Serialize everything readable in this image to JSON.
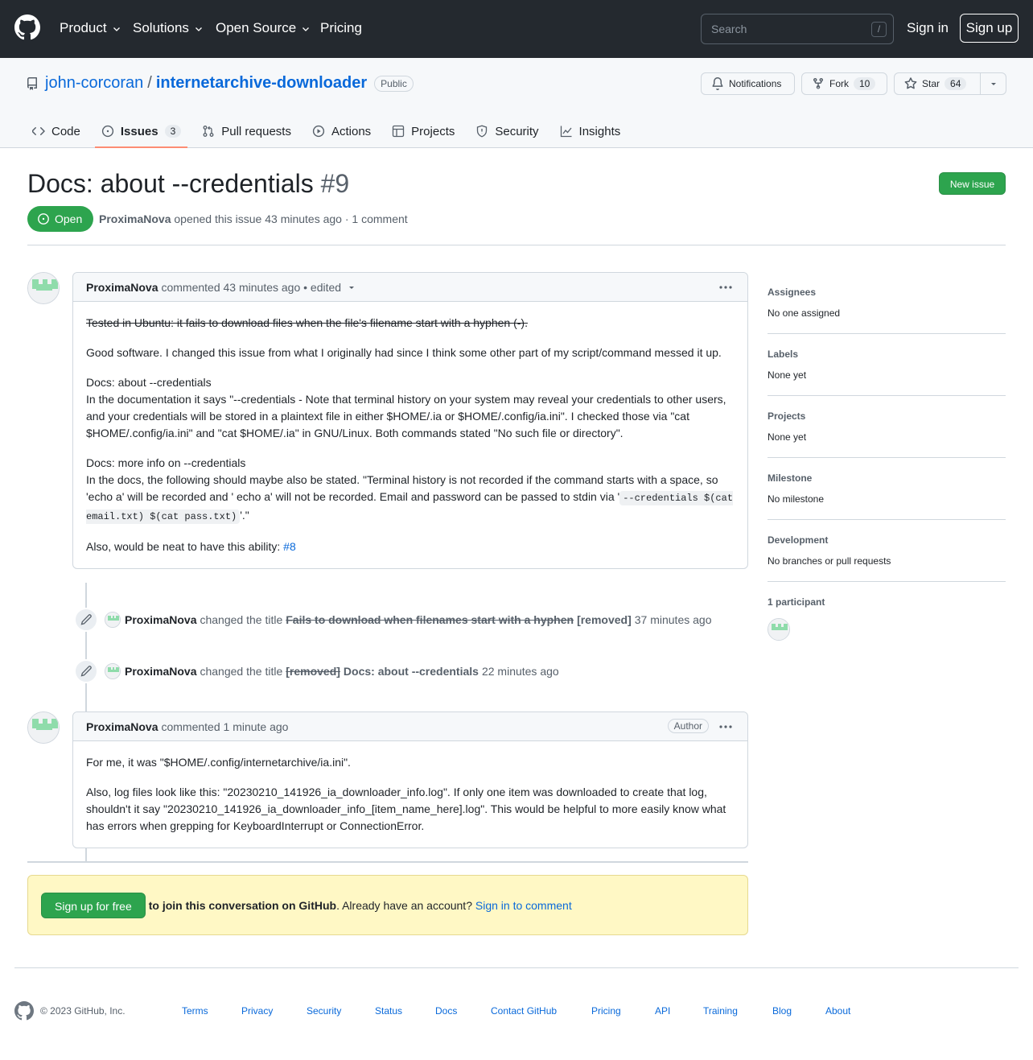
{
  "header": {
    "nav": [
      {
        "label": "Product",
        "has_dropdown": true
      },
      {
        "label": "Solutions",
        "has_dropdown": true
      },
      {
        "label": "Open Source",
        "has_dropdown": true
      },
      {
        "label": "Pricing",
        "has_dropdown": false
      }
    ],
    "search_placeholder": "Search",
    "search_shortcut": "/",
    "sign_in": "Sign in",
    "sign_up": "Sign up"
  },
  "repo": {
    "owner": "john-corcoran",
    "separator": "/",
    "name": "internetarchive-downloader",
    "visibility": "Public",
    "notifications_label": "Notifications",
    "fork_label": "Fork",
    "fork_count": "10",
    "star_label": "Star",
    "star_count": "64",
    "tabs": [
      {
        "label": "Code",
        "icon": "code-icon"
      },
      {
        "label": "Issues",
        "icon": "issue-opened-icon",
        "count": "3",
        "active": true
      },
      {
        "label": "Pull requests",
        "icon": "git-pull-request-icon"
      },
      {
        "label": "Actions",
        "icon": "play-icon"
      },
      {
        "label": "Projects",
        "icon": "table-icon"
      },
      {
        "label": "Security",
        "icon": "shield-icon"
      },
      {
        "label": "Insights",
        "icon": "graph-icon"
      }
    ]
  },
  "issue": {
    "title": "Docs: about --credentials",
    "number": "#9",
    "new_issue_label": "New issue",
    "state": "Open",
    "author": "ProximaNova",
    "meta_text": "opened this issue 43 minutes ago · 1 comment"
  },
  "timeline": {
    "comment1": {
      "author": "ProximaNova",
      "header_text": "commented 43 minutes ago • edited",
      "struck_line": "Tested in Ubuntu: it fails to download files when the file's filename start with a hyphen (-).",
      "p1": "Good software. I changed this issue from what I originally had since I think some other part of my script/command messed it up.",
      "p2_title": "Docs: about --credentials",
      "p2_body": "In the documentation it says \"--credentials - Note that terminal history on your system may reveal your credentials to other users, and your credentials will be stored in a plaintext file in either $HOME/.ia or $HOME/.config/ia.ini\". I checked those via \"cat $HOME/.config/ia.ini\" and \"cat $HOME/.ia\" in GNU/Linux. Both commands stated \"No such file or directory\".",
      "p3_title": "Docs: more info on --credentials",
      "p3_body_a": "In the docs, the following should maybe also be stated. \"Terminal history is not recorded if the command starts with a space, so 'echo a' will be recorded and ' echo a' will not be recorded. Email and password can be passed to stdin via '",
      "p3_code": "--credentials $(cat email.txt) $(cat pass.txt)",
      "p3_body_b": "'.\"",
      "p4_text": "Also, would be neat to have this ability:",
      "p4_link": "#8"
    },
    "event1": {
      "author": "ProximaNova",
      "action": "changed the title",
      "old_title": "Fails to download when filenames start with a hyphen",
      "new_title": "[removed]",
      "time": "37 minutes ago"
    },
    "event2": {
      "author": "ProximaNova",
      "action": "changed the title",
      "old_title": "[removed]",
      "new_title": "Docs: about --credentials",
      "time": "22 minutes ago"
    },
    "comment2": {
      "author": "ProximaNova",
      "header_text": "commented 1 minute ago",
      "badge": "Author",
      "p1": "For me, it was \"$HOME/.config/internetarchive/ia.ini\".",
      "p2": "Also, log files look like this: \"20230210_141926_ia_downloader_info.log\". If only one item was downloaded to create that log, shouldn't it say \"20230210_141926_ia_downloader_info_[item_name_here].log\". This would be helpful to more easily know what has errors when grepping for KeyboardInterrupt or ConnectionError."
    }
  },
  "signup_box": {
    "button": "Sign up for free",
    "bold_text": "to join this conversation on GitHub",
    "text": ". Already have an account?",
    "link": "Sign in to comment"
  },
  "sidebar": [
    {
      "heading": "Assignees",
      "value": "No one assigned"
    },
    {
      "heading": "Labels",
      "value": "None yet"
    },
    {
      "heading": "Projects",
      "value": "None yet"
    },
    {
      "heading": "Milestone",
      "value": "No milestone"
    },
    {
      "heading": "Development",
      "value": "No branches or pull requests"
    },
    {
      "heading": "1 participant",
      "value": ""
    }
  ],
  "footer": {
    "copyright": "© 2023 GitHub, Inc.",
    "links": [
      "Terms",
      "Privacy",
      "Security",
      "Status",
      "Docs",
      "Contact GitHub",
      "Pricing",
      "API",
      "Training",
      "Blog",
      "About"
    ]
  },
  "colors": {
    "header_bg": "#24292f",
    "open_green": "#2da44e",
    "link_blue": "#0969da",
    "tab_underline": "#fd8c73",
    "signup_box_bg": "#fff8c5"
  }
}
